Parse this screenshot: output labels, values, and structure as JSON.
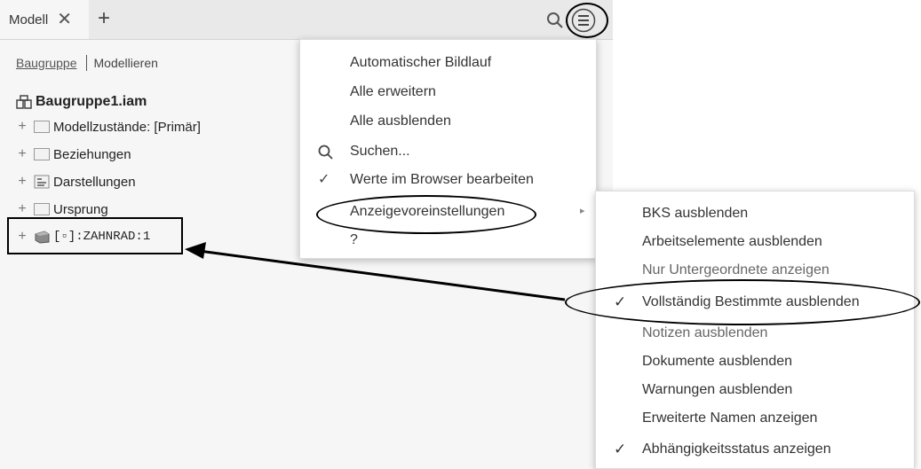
{
  "tabbar": {
    "tab_label": "Modell",
    "close_glyph": "✕",
    "add_glyph": "+"
  },
  "modes": {
    "active": "Baugruppe",
    "other": "Modellieren"
  },
  "tree": {
    "root": "Baugruppe1.iam",
    "items": [
      {
        "label": "Modellzustände: [Primär]",
        "icon": "folder-icon"
      },
      {
        "label": "Beziehungen",
        "icon": "folder-icon"
      },
      {
        "label": "Darstellungen",
        "icon": "representations-icon"
      },
      {
        "label": "Ursprung",
        "icon": "folder-icon"
      },
      {
        "label": "[▫]:ZAHNRAD:1",
        "icon": "part-icon"
      }
    ]
  },
  "menu1": {
    "items": [
      {
        "label": "Automatischer Bildlauf",
        "icon": ""
      },
      {
        "label": "Alle erweitern",
        "icon": ""
      },
      {
        "label": "Alle ausblenden",
        "icon": ""
      },
      {
        "label": "Suchen...",
        "icon": "search-icon"
      },
      {
        "label": "Werte im Browser bearbeiten",
        "icon": "check-icon"
      },
      {
        "label": "Anzeigevoreinstellungen",
        "icon": ""
      },
      {
        "label": "?",
        "icon": ""
      }
    ]
  },
  "menu2": {
    "items": [
      {
        "label": "BKS ausblenden",
        "checked": false
      },
      {
        "label": "Arbeitselemente ausblenden",
        "checked": false
      },
      {
        "label": "Nur Untergeordnete anzeigen",
        "checked": false
      },
      {
        "label": "Vollständig Bestimmte ausblenden",
        "checked": true
      },
      {
        "label": "Notizen ausblenden",
        "checked": false
      },
      {
        "label": "Dokumente ausblenden",
        "checked": false
      },
      {
        "label": "Warnungen ausblenden",
        "checked": false
      },
      {
        "label": "Erweiterte Namen anzeigen",
        "checked": false
      },
      {
        "label": "Abhängigkeitsstatus anzeigen",
        "checked": true
      }
    ]
  },
  "colors": {
    "panel_bg": "#f6f6f6",
    "tabbar_bg": "#e9e9e9",
    "annotation": "#000000"
  }
}
